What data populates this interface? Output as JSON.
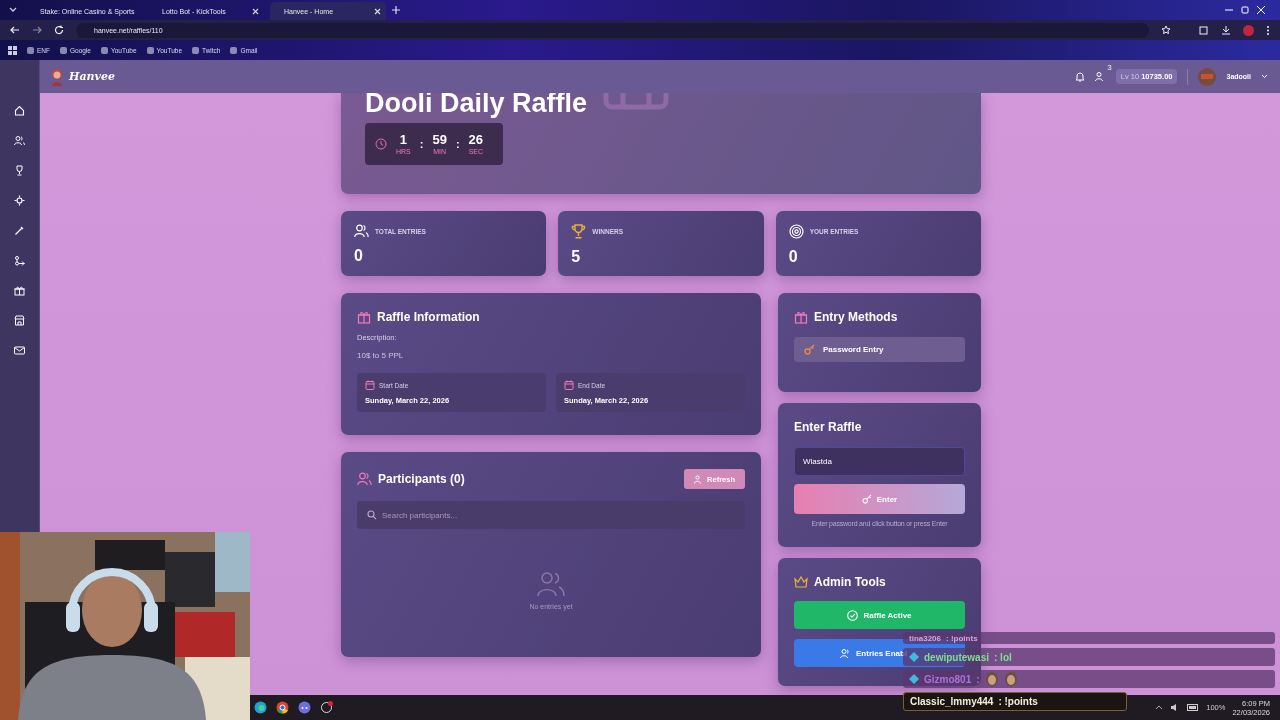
{
  "browser": {
    "tabs": [
      {
        "title": "Stake: Online Casino & Sports",
        "selected": false
      },
      {
        "title": "Lotto Bot - KickTools",
        "selected": false
      },
      {
        "title": "Hanvee - Home",
        "selected": true
      }
    ],
    "url": "hanvee.net/raffles/110",
    "bookmarks": [
      "ENF",
      "Google",
      "YouTube",
      "YouTube",
      "Twitch",
      "Gmail"
    ]
  },
  "header": {
    "logo": "Hanvee",
    "friend_badge": "3",
    "level": "Lv 10",
    "balance": "10735.00",
    "username": "3adooli"
  },
  "raffle": {
    "title": "Dooli Daily Raffle",
    "countdown": [
      {
        "kind": "unit",
        "value": "1",
        "label": "HRS"
      },
      {
        "kind": "separator",
        "value": ":"
      },
      {
        "kind": "unit",
        "value": "59",
        "label": "MIN"
      },
      {
        "kind": "separator",
        "value": ":"
      },
      {
        "kind": "unit",
        "value": "26",
        "label": "SEC"
      }
    ]
  },
  "stats": [
    {
      "kind": "users",
      "label": "TOTAL ENTRIES",
      "value": "0"
    },
    {
      "kind": "trophy",
      "label": "WINNERS",
      "value": "5"
    },
    {
      "kind": "target",
      "label": "YOUR ENTRIES",
      "value": "0"
    }
  ],
  "info": {
    "title": "Raffle Information",
    "description_label": "Description:",
    "description": "10$ to 5 PPL",
    "dates": [
      {
        "label": "Start Date",
        "value": "Sunday, March 22, 2026"
      },
      {
        "label": "End Date",
        "value": "Sunday, March 22, 2026"
      }
    ]
  },
  "participants": {
    "title": "Participants (0)",
    "refresh": "Refresh",
    "placeholder": "Search participants...",
    "empty": "No entries yet"
  },
  "entry_methods": {
    "title": "Entry Methods",
    "methods": [
      "Password Entry"
    ]
  },
  "enter": {
    "title": "Enter Raffle",
    "value": "Wlastda",
    "button": "Enter",
    "hint": "Enter password and click button or press Enter"
  },
  "admin": {
    "title": "Admin Tools",
    "buttons": [
      {
        "kind": "active",
        "label": "Raffle Active"
      },
      {
        "kind": "entries",
        "label": "Entries Enabl"
      }
    ]
  },
  "chat": [
    {
      "kind": "text",
      "user": "tina3206",
      "text": ": !points",
      "color": "#cfa6dc",
      "badge": false
    },
    {
      "kind": "text",
      "user": "dewiputewasi",
      "text": ": lol",
      "color": "#7be08f",
      "badge": true
    },
    {
      "kind": "emote",
      "user": "Gizmo801",
      "text": ":",
      "color": "#b06fe0",
      "badge": true
    },
    {
      "kind": "text",
      "user": "Classic_lmmy444",
      "text": ": !points",
      "color": "#f4f0d8",
      "badge": false
    }
  ],
  "taskbar": {
    "battery": "100%",
    "time": "6:09 PM",
    "date": "22/03/2026"
  }
}
